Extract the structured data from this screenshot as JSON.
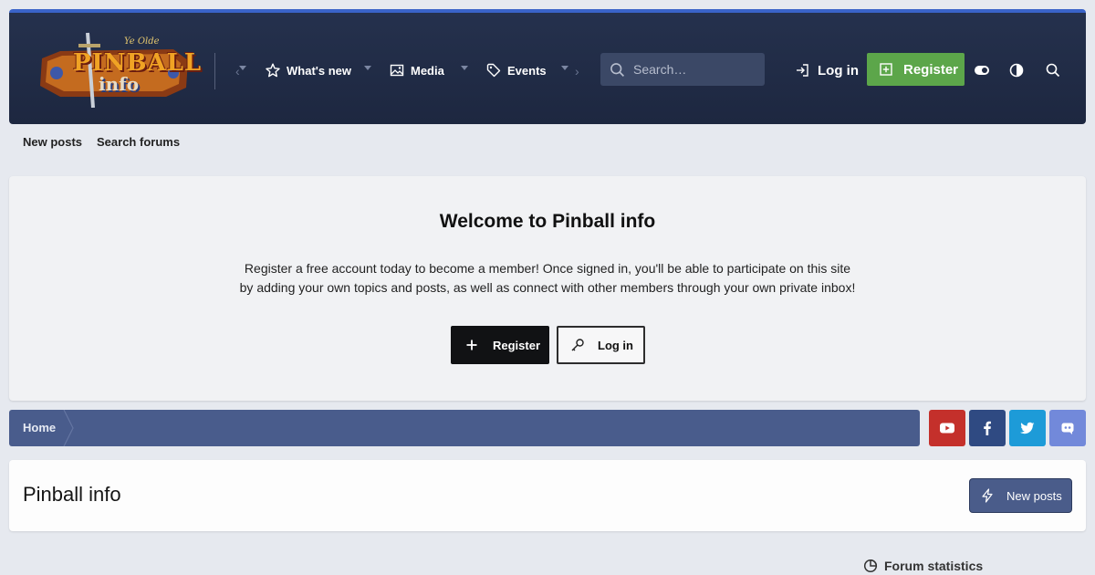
{
  "logo": {
    "small_text": "Ye Olde",
    "title": "PINBALL",
    "subtitle": "info"
  },
  "header": {
    "nav": [
      {
        "label": "What's new",
        "icon": "star-icon"
      },
      {
        "label": "Media",
        "icon": "image-icon"
      },
      {
        "label": "Events",
        "icon": "tag-icon"
      }
    ],
    "search_placeholder": "Search…",
    "login_label": "Log in",
    "register_label": "Register"
  },
  "subnav": {
    "new_posts": "New posts",
    "search_forums": "Search forums"
  },
  "welcome": {
    "title": "Welcome to Pinball info",
    "text": "Register a free account today to become a member! Once signed in, you'll be able to participate on this site by adding your own topics and posts, as well as connect with other members through your own private inbox!",
    "register_label": "Register",
    "login_label": "Log in"
  },
  "breadcrumb": {
    "home": "Home"
  },
  "social": [
    {
      "name": "youtube",
      "color": "#c4302b"
    },
    {
      "name": "facebook",
      "color": "#2f4a82"
    },
    {
      "name": "twitter",
      "color": "#1d9bd8"
    },
    {
      "name": "discord",
      "color": "#7289da"
    }
  ],
  "page": {
    "title": "Pinball info",
    "new_posts_label": "New posts"
  },
  "stats": {
    "heading": "Forum statistics"
  },
  "colors": {
    "header_bg": "#1d2740",
    "accent": "#3a63c8",
    "register_green": "#5ca64a",
    "breadcrumb_bg": "#495c8c"
  }
}
